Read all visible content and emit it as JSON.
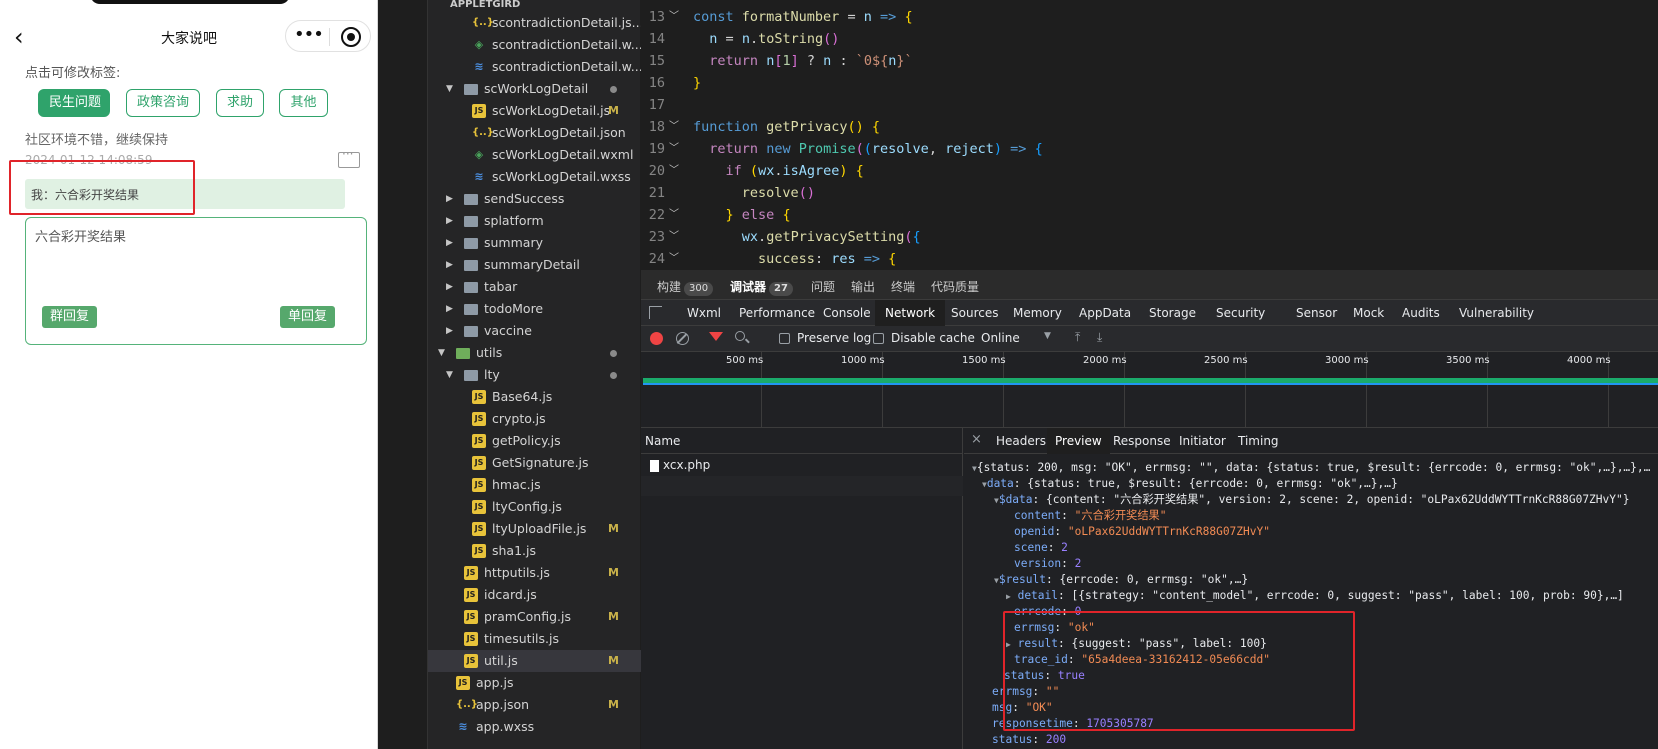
{
  "phone": {
    "nav_title": "大家说吧",
    "back_glyph": "‹",
    "menu_glyph": "•••",
    "tag_hint": "点击可修改标签:",
    "tags": [
      {
        "label": "民生问题",
        "active": true
      },
      {
        "label": "政策咨询",
        "active": false
      },
      {
        "label": "求助",
        "active": false
      },
      {
        "label": "其他",
        "active": false
      }
    ],
    "post_text": "社区环境不错，继续保持",
    "post_date": "2024-01-12 14:08:59",
    "reply_bubble": "我：六合彩开奖结果",
    "reply_input": "六合彩开奖结果",
    "group_reply": "群回复",
    "single_reply": "单回复"
  },
  "explorer": {
    "header": "APPLETGIRD",
    "items": [
      {
        "name": "scontradictionDetail.js...",
        "icon": "json",
        "depth": 3
      },
      {
        "name": "scontradictionDetail.w...",
        "icon": "wxml",
        "depth": 3
      },
      {
        "name": "scontradictionDetail.w...",
        "icon": "wxss",
        "depth": 3
      },
      {
        "name": "scWorkLogDetail",
        "icon": "folder",
        "depth": 2,
        "open": true,
        "dot": true
      },
      {
        "name": "scWorkLogDetail.js",
        "icon": "js",
        "depth": 3,
        "status": "M"
      },
      {
        "name": "scWorkLogDetail.json",
        "icon": "json",
        "depth": 3
      },
      {
        "name": "scWorkLogDetail.wxml",
        "icon": "wxml",
        "depth": 3
      },
      {
        "name": "scWorkLogDetail.wxss",
        "icon": "wxss",
        "depth": 3
      },
      {
        "name": "sendSuccess",
        "icon": "folder",
        "depth": 2,
        "open": false
      },
      {
        "name": "splatform",
        "icon": "folder",
        "depth": 2,
        "open": false
      },
      {
        "name": "summary",
        "icon": "folder",
        "depth": 2,
        "open": false
      },
      {
        "name": "summaryDetail",
        "icon": "folder",
        "depth": 2,
        "open": false
      },
      {
        "name": "tabar",
        "icon": "folder",
        "depth": 2,
        "open": false
      },
      {
        "name": "todoMore",
        "icon": "folder",
        "depth": 2,
        "open": false
      },
      {
        "name": "vaccine",
        "icon": "folder",
        "depth": 2,
        "open": false
      },
      {
        "name": "utils",
        "icon": "folder-green",
        "depth": 1,
        "open": true,
        "dot": true
      },
      {
        "name": "lty",
        "icon": "folder",
        "depth": 2,
        "open": true,
        "dot": true
      },
      {
        "name": "Base64.js",
        "icon": "js",
        "depth": 3
      },
      {
        "name": "crypto.js",
        "icon": "js",
        "depth": 3
      },
      {
        "name": "getPolicy.js",
        "icon": "js",
        "depth": 3
      },
      {
        "name": "GetSignature.js",
        "icon": "js",
        "depth": 3
      },
      {
        "name": "hmac.js",
        "icon": "js",
        "depth": 3
      },
      {
        "name": "ltyConfig.js",
        "icon": "js",
        "depth": 3
      },
      {
        "name": "ltyUploadFile.js",
        "icon": "js",
        "depth": 3,
        "status": "M"
      },
      {
        "name": "sha1.js",
        "icon": "js",
        "depth": 3
      },
      {
        "name": "httputils.js",
        "icon": "js",
        "depth": 2,
        "status": "M"
      },
      {
        "name": "idcard.js",
        "icon": "js",
        "depth": 2
      },
      {
        "name": "pramConfig.js",
        "icon": "js",
        "depth": 2,
        "status": "M"
      },
      {
        "name": "timesutils.js",
        "icon": "js",
        "depth": 2
      },
      {
        "name": "util.js",
        "icon": "js",
        "depth": 2,
        "status": "M",
        "selected": true
      },
      {
        "name": "app.js",
        "icon": "js",
        "depth": 1
      },
      {
        "name": "app.json",
        "icon": "json",
        "depth": 1,
        "status": "M"
      },
      {
        "name": "app.wxss",
        "icon": "wxss",
        "depth": 1
      }
    ]
  },
  "editor": {
    "line_numbers": [
      "13",
      "14",
      "15",
      "16",
      "17",
      "18",
      "19",
      "20",
      "21",
      "22",
      "23",
      "24"
    ]
  },
  "devtools": {
    "top_tabs": [
      {
        "label": "构建",
        "badge": "300"
      },
      {
        "label": "调试器",
        "badge": "27",
        "active": true
      },
      {
        "label": "问题"
      },
      {
        "label": "输出"
      },
      {
        "label": "终端"
      },
      {
        "label": "代码质量"
      }
    ],
    "panel_tabs": [
      "Wxml",
      "Performance",
      "Console",
      "Network",
      "Sources",
      "Memory",
      "AppData",
      "Storage",
      "Security",
      "Sensor",
      "Mock",
      "Audits",
      "Vulnerability"
    ],
    "active_panel": "Network",
    "preserve_log": "Preserve log",
    "disable_cache": "Disable cache",
    "throttle": "Online",
    "timeline_ticks": [
      "500 ms",
      "1000 ms",
      "1500 ms",
      "2000 ms",
      "2500 ms",
      "3000 ms",
      "3500 ms",
      "4000 ms"
    ],
    "name_header": "Name",
    "request_name": "xcx.php",
    "detail_tabs": [
      "Headers",
      "Preview",
      "Response",
      "Initiator",
      "Timing"
    ],
    "active_detail": "Preview"
  },
  "preview": {
    "root": "{status: 200, msg: \"OK\", errmsg: \"\", data: {status: true, $result: {errcode: 0, errmsg: \"ok\",…},…},…",
    "data_summary": "{status: true, $result: {errcode: 0, errmsg: \"ok\",…},…}",
    "data_data_summary": "{content: \"六合彩开奖结果\", version: 2, scene: 2, openid: \"oLPax62UddWYTTrnKcR88G07ZHvY\"}",
    "content": "\"六合彩开奖结果\"",
    "openid": "\"oLPax62UddWYTTrnKcR88G07ZHvY\"",
    "scene": "2",
    "version": "2",
    "result_summary": "{errcode: 0, errmsg: \"ok\",…}",
    "detail_summary": "[{strategy: \"content_model\", errcode: 0, suggest: \"pass\", label: 100, prob: 90},…]",
    "errcode": "0",
    "errmsg": "\"ok\"",
    "result_inner": "{suggest: \"pass\", label: 100}",
    "trace_id": "\"65a4deea-33162412-05e66cdd\"",
    "status_true": "true",
    "errmsg_outer": "\"\"",
    "msg": "\"OK\"",
    "responsetime": "1705305787",
    "status_200": "200"
  }
}
